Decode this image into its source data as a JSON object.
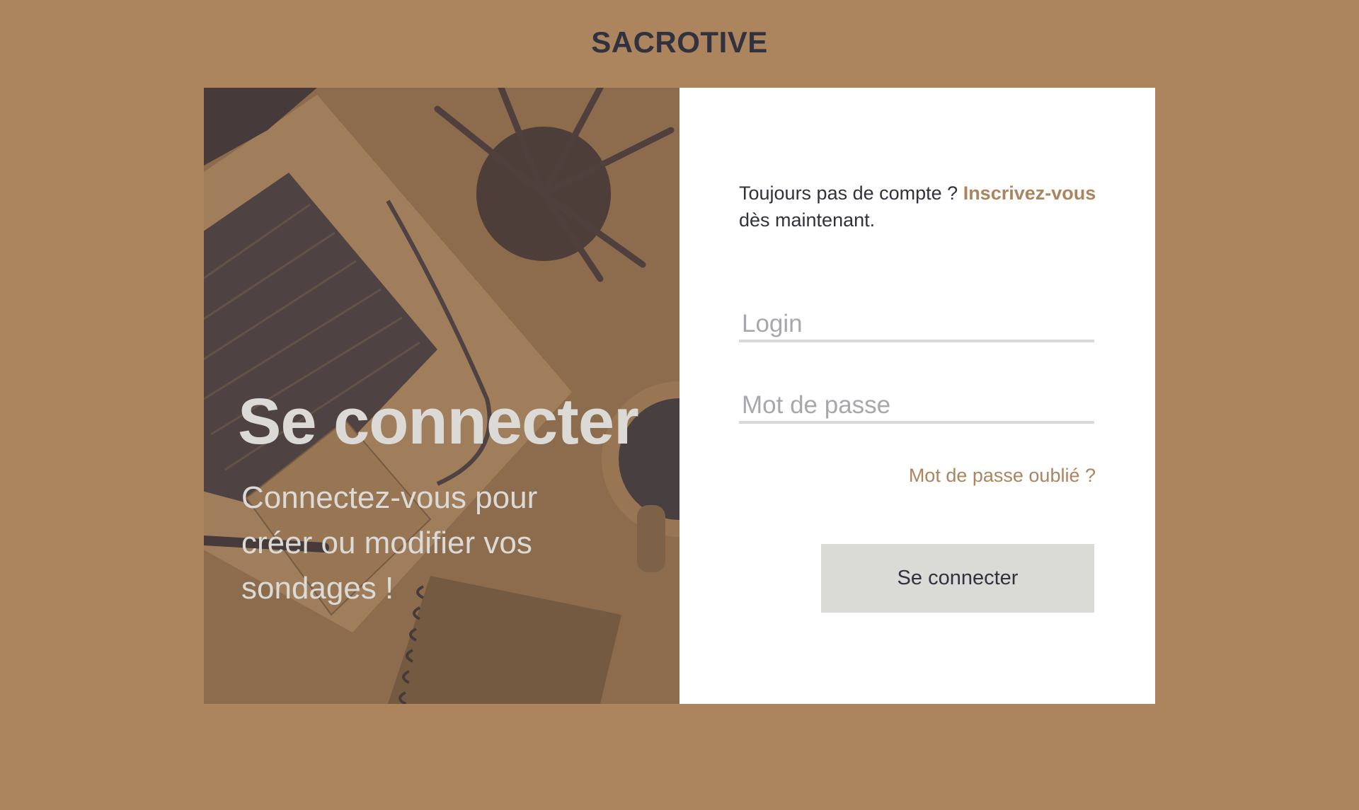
{
  "brand": {
    "title": "SACROTIVE"
  },
  "hero": {
    "title": "Se connecter",
    "subtitle": "Connectez-vous pour créer ou modifier vos sondages !"
  },
  "form": {
    "signup_prefix": "Toujours pas de compte ? ",
    "signup_link": "Inscrivez-vous",
    "signup_suffix": " dès maintenant.",
    "login_placeholder": "Login",
    "password_placeholder": "Mot de passe",
    "forgot_label": "Mot de passe oublié ?",
    "submit_label": "Se connecter"
  },
  "colors": {
    "background": "#ac845e",
    "accent": "#ac845e",
    "dark_text": "#32323f",
    "button": "#dadad7"
  }
}
